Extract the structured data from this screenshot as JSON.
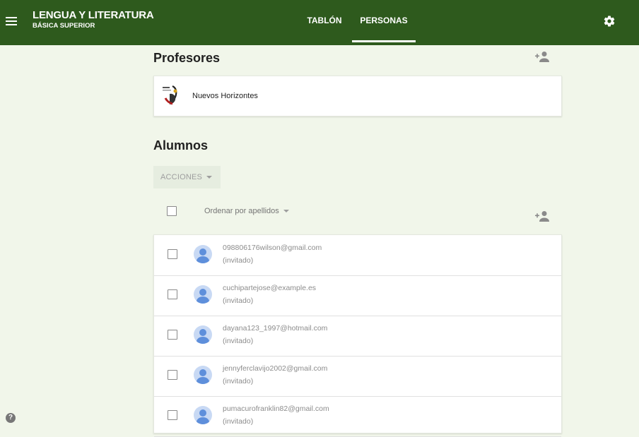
{
  "header": {
    "course_title": "LENGUA Y LITERATURA",
    "course_subtitle": "BÁSICA SUPERIOR",
    "tabs": [
      {
        "label": "TABLÓN",
        "active": false
      },
      {
        "label": "PERSONAS",
        "active": true
      }
    ],
    "icons": {
      "menu": "menu-icon",
      "settings": "gear-icon"
    }
  },
  "teachers": {
    "title": "Profesores",
    "add_icon": "add-person-icon",
    "items": [
      {
        "name": "Nuevos Horizontes",
        "avatar": "school-logo"
      }
    ]
  },
  "students": {
    "title": "Alumnos",
    "actions_label": "ACCIONES",
    "sort_label": "Ordenar por apellidos",
    "add_icon": "add-person-icon",
    "items": [
      {
        "email": "098806176wilson@gmail.com",
        "status": "(invitado)"
      },
      {
        "email": "cuchipartejose@example.es",
        "status": "(invitado)"
      },
      {
        "email": "dayana123_1997@hotmail.com",
        "status": "(invitado)"
      },
      {
        "email": "jennyferclavijo2002@gmail.com",
        "status": "(invitado)"
      },
      {
        "email": "pumacurofranklin82@gmail.com",
        "status": "(invitado)"
      }
    ]
  },
  "footer": {
    "help_glyph": "?"
  },
  "colors": {
    "header_bg": "#2e5a1d",
    "page_bg": "#f1f6ea",
    "avatar_blue": "#5e8fdb"
  }
}
